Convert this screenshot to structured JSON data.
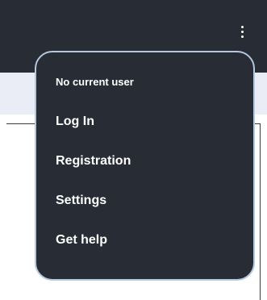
{
  "header": {
    "menu_icon": "more-vertical-icon"
  },
  "dropdown": {
    "user_status": "No current user",
    "items": [
      {
        "label": "Log In"
      },
      {
        "label": "Registration"
      },
      {
        "label": "Settings"
      },
      {
        "label": "Get help"
      }
    ]
  },
  "colors": {
    "header_bg": "#272c35",
    "menu_bg": "#272c35",
    "menu_border": "#b6c7de",
    "band_bg": "#eaedf5",
    "text": "#ffffff"
  }
}
